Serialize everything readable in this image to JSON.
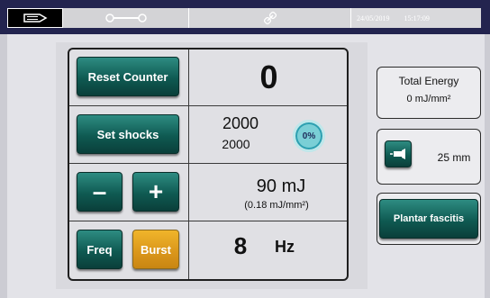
{
  "topbar": {
    "datetime_date": "24/05/2019",
    "datetime_time": "15:17:09",
    "tab_icons": [
      "handpiece-icon",
      "wrench-icon",
      "link-icon"
    ]
  },
  "left_panel": {
    "reset_counter_label": "Reset Counter",
    "counter_value": "0",
    "set_shocks_label": "Set shocks",
    "shocks_set": "2000",
    "shocks_remaining": "2000",
    "progress_percent": "0%",
    "minus_label": "–",
    "plus_label": "+",
    "energy_value": "90 mJ",
    "energy_density": "(0.18 mJ/mm²)",
    "freq_label": "Freq",
    "burst_label": "Burst",
    "frequency_value": "8",
    "frequency_unit": "Hz"
  },
  "right_panel": {
    "total_energy_label": "Total Energy",
    "total_energy_value": "0 mJ/mm²",
    "applicator_size": "25 mm",
    "protocol_label": "Plantar fascitis"
  },
  "colors": {
    "topbar": "#23244f",
    "button_teal": "#0f5a52",
    "button_burst": "#d9951a",
    "progress_ring": "#2d9fb0"
  }
}
